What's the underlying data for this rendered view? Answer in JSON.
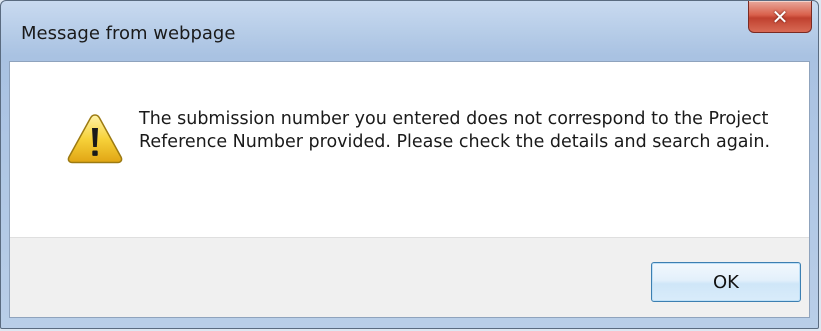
{
  "dialog": {
    "title": "Message from webpage",
    "close_label": "✕",
    "message": "The submission number you entered does not correspond to the Project Reference Number provided. Please check the details and search again.",
    "icon": "warning-icon",
    "ok_label": "OK"
  },
  "colors": {
    "titlebar": "#b7cde8",
    "close_button": "#c9503d",
    "button_area": "#f0f0f0",
    "ok_border": "#3c7fb1"
  }
}
